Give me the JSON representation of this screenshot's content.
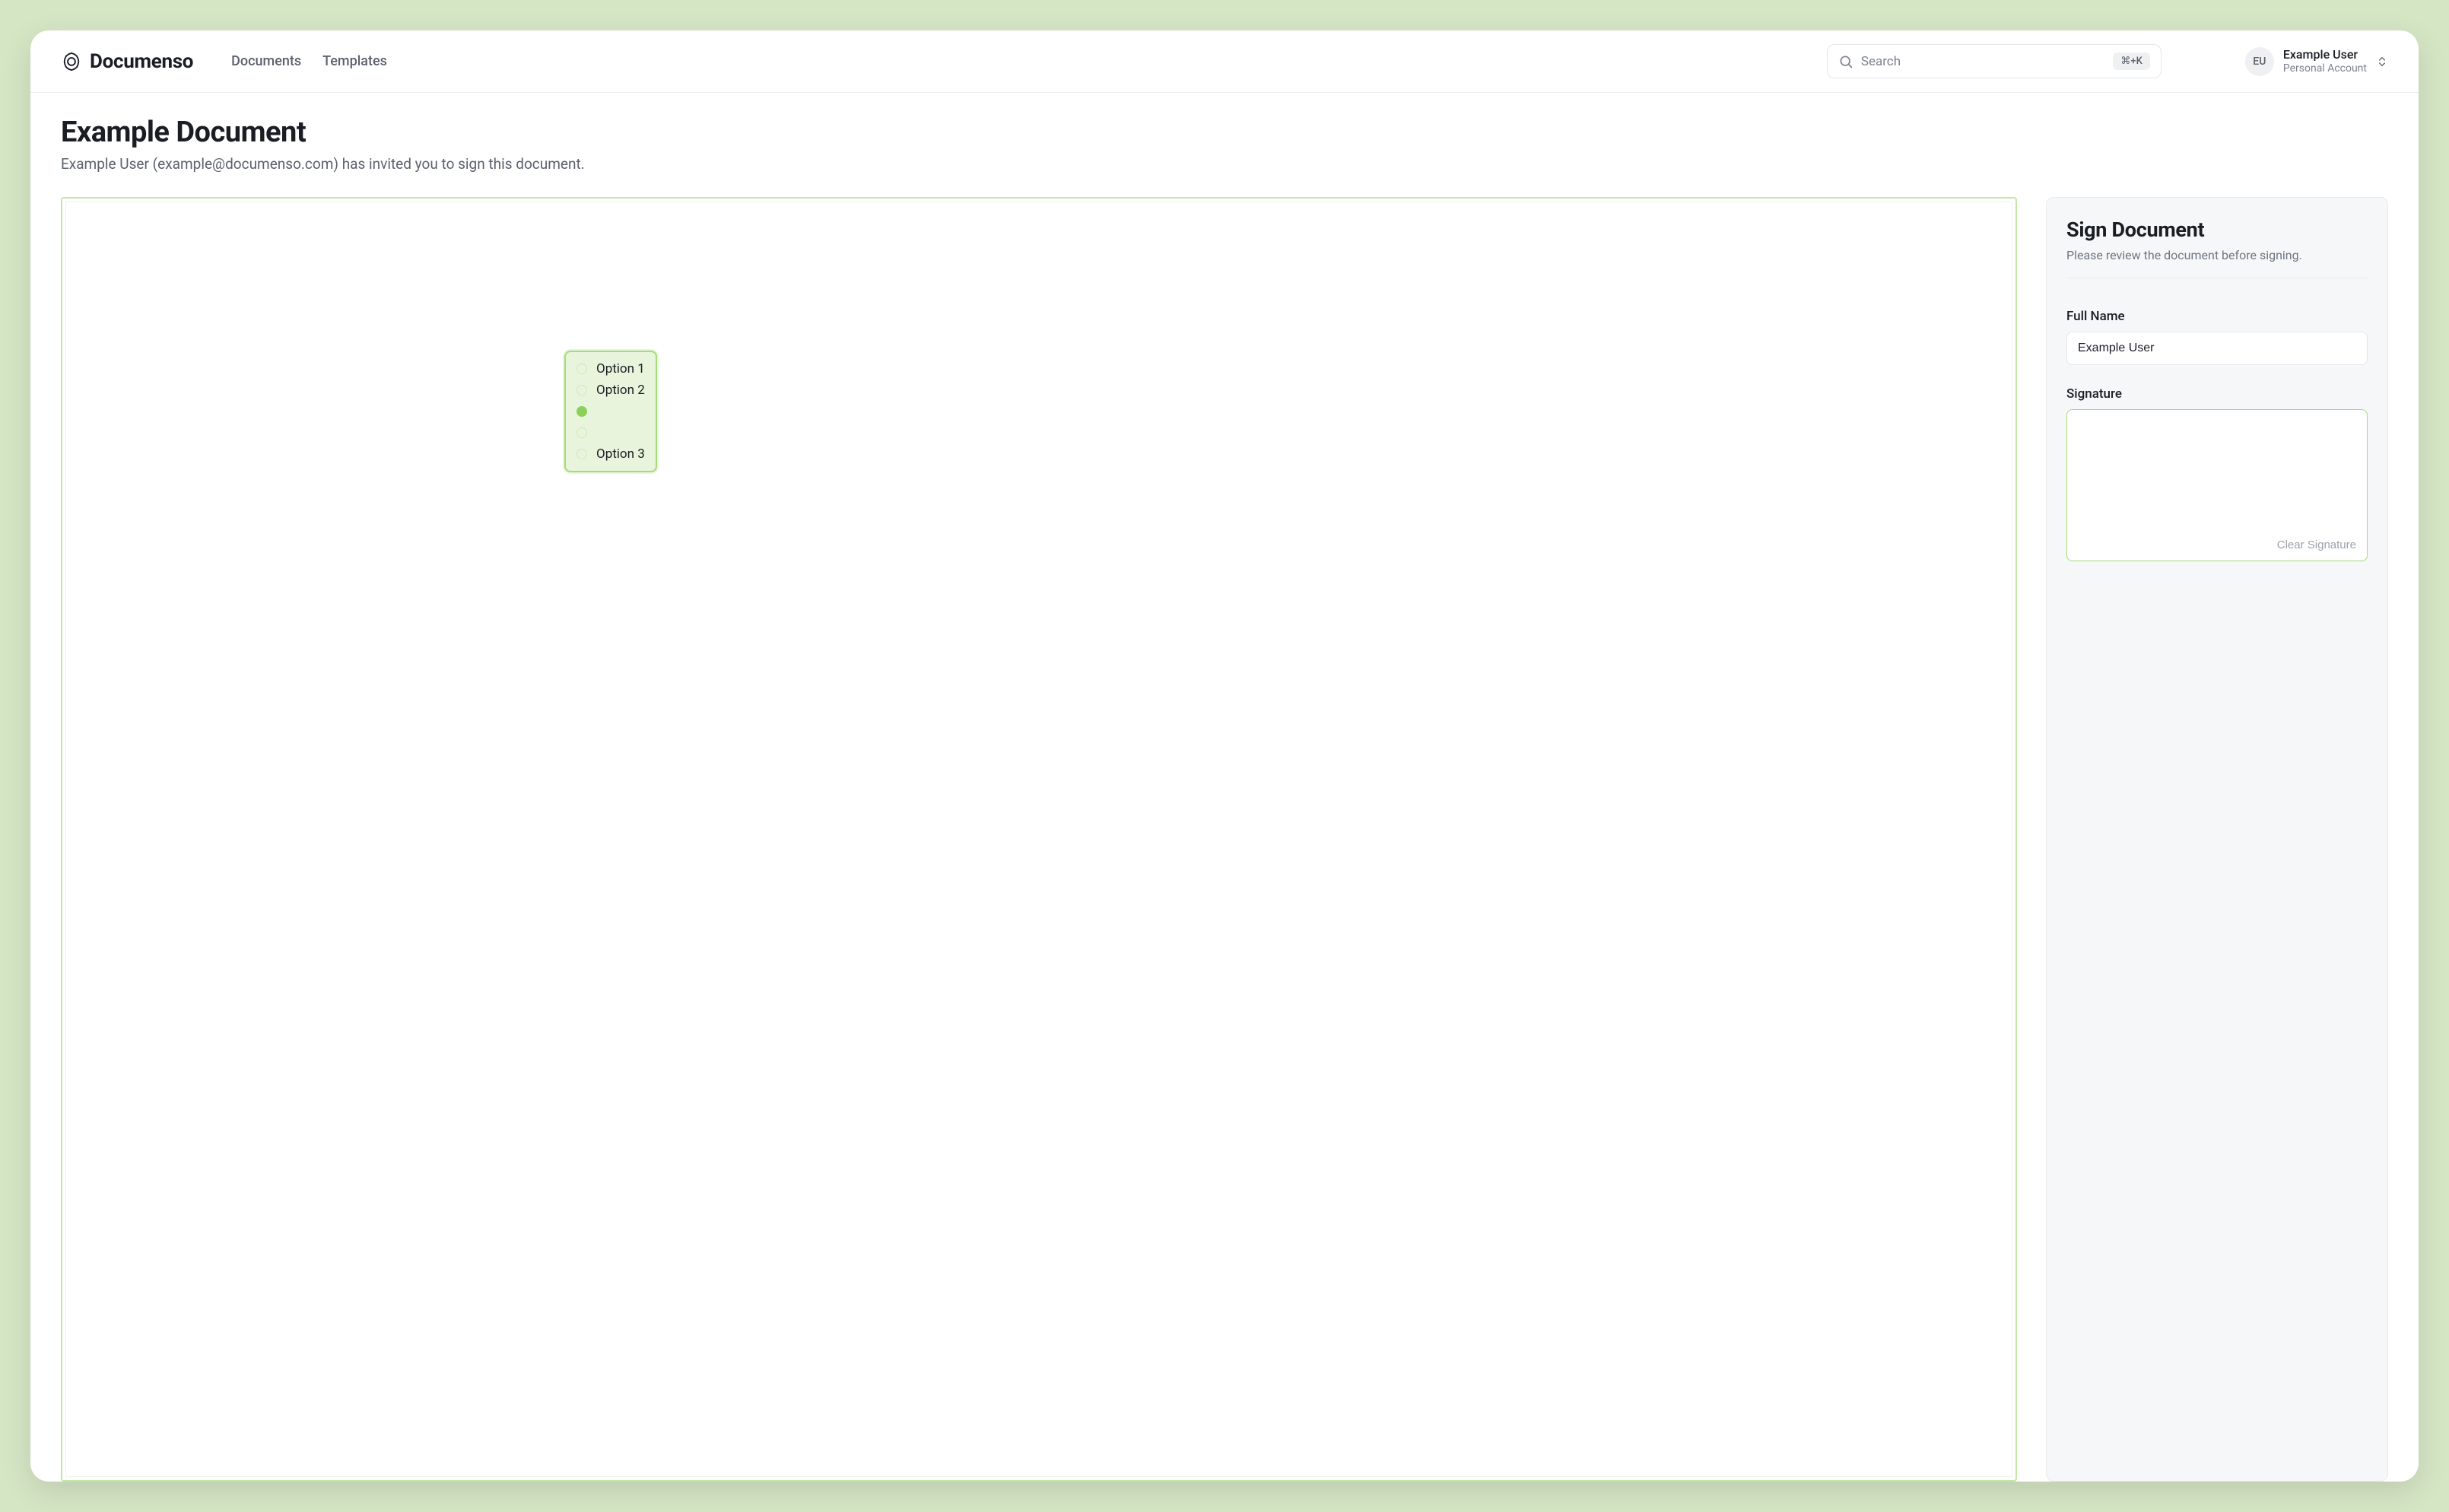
{
  "brand": {
    "name": "Documenso"
  },
  "nav": {
    "documents": "Documents",
    "templates": "Templates"
  },
  "search": {
    "placeholder": "Search",
    "shortcut": "⌘+K"
  },
  "account": {
    "initials": "EU",
    "name": "Example User",
    "sub": "Personal Account"
  },
  "page": {
    "title": "Example Document",
    "subtext": "Example User (example@documenso.com) has invited you to sign this document."
  },
  "radio_field": {
    "options": [
      {
        "label": "Option 1",
        "selected": false
      },
      {
        "label": "Option 2",
        "selected": false
      },
      {
        "label": "",
        "selected": true
      },
      {
        "label": "",
        "selected": false
      },
      {
        "label": "Option 3",
        "selected": false
      }
    ]
  },
  "side": {
    "title": "Sign Document",
    "sub": "Please review the document before signing.",
    "full_name_label": "Full Name",
    "full_name_value": "Example User",
    "signature_label": "Signature",
    "clear_signature": "Clear Signature"
  }
}
